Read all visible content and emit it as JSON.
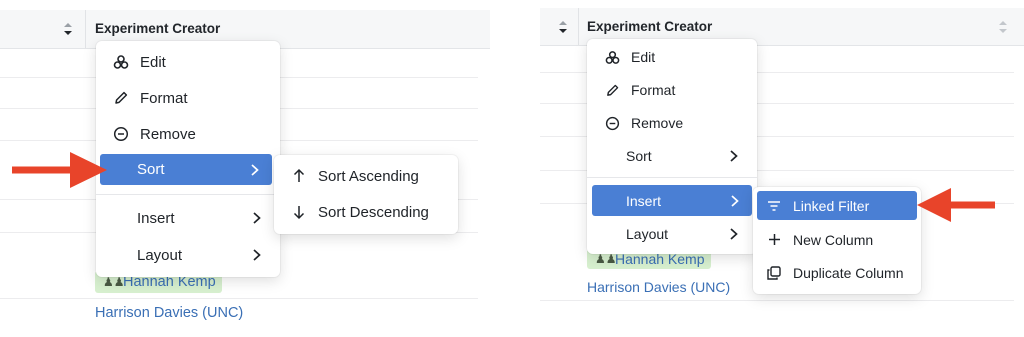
{
  "left_panel": {
    "column_header": "Experiment Creator",
    "menu": {
      "edit": "Edit",
      "format": "Format",
      "remove": "Remove",
      "sort": "Sort",
      "insert": "Insert",
      "layout": "Layout"
    },
    "submenu": {
      "sort_ascending": "Sort Ascending",
      "sort_descending": "Sort Descending"
    },
    "rows": {
      "tag_name": "Hannah Kemp",
      "link_name": "Harrison Davies (UNC)"
    }
  },
  "right_panel": {
    "column_header": "Experiment Creator",
    "menu": {
      "edit": "Edit",
      "format": "Format",
      "remove": "Remove",
      "sort": "Sort",
      "insert": "Insert",
      "layout": "Layout"
    },
    "submenu": {
      "linked_filter": "Linked Filter",
      "new_column": "New Column",
      "duplicate_column": "Duplicate Column"
    },
    "rows": {
      "tag_name": "Hannah Kemp",
      "link_name": "Harrison Davies (UNC)"
    }
  },
  "colors": {
    "active_item": "#4a7fd4",
    "arrow": "#e8442a",
    "link_text": "#3a6fb5",
    "tag_background": "#d7f0cf"
  }
}
